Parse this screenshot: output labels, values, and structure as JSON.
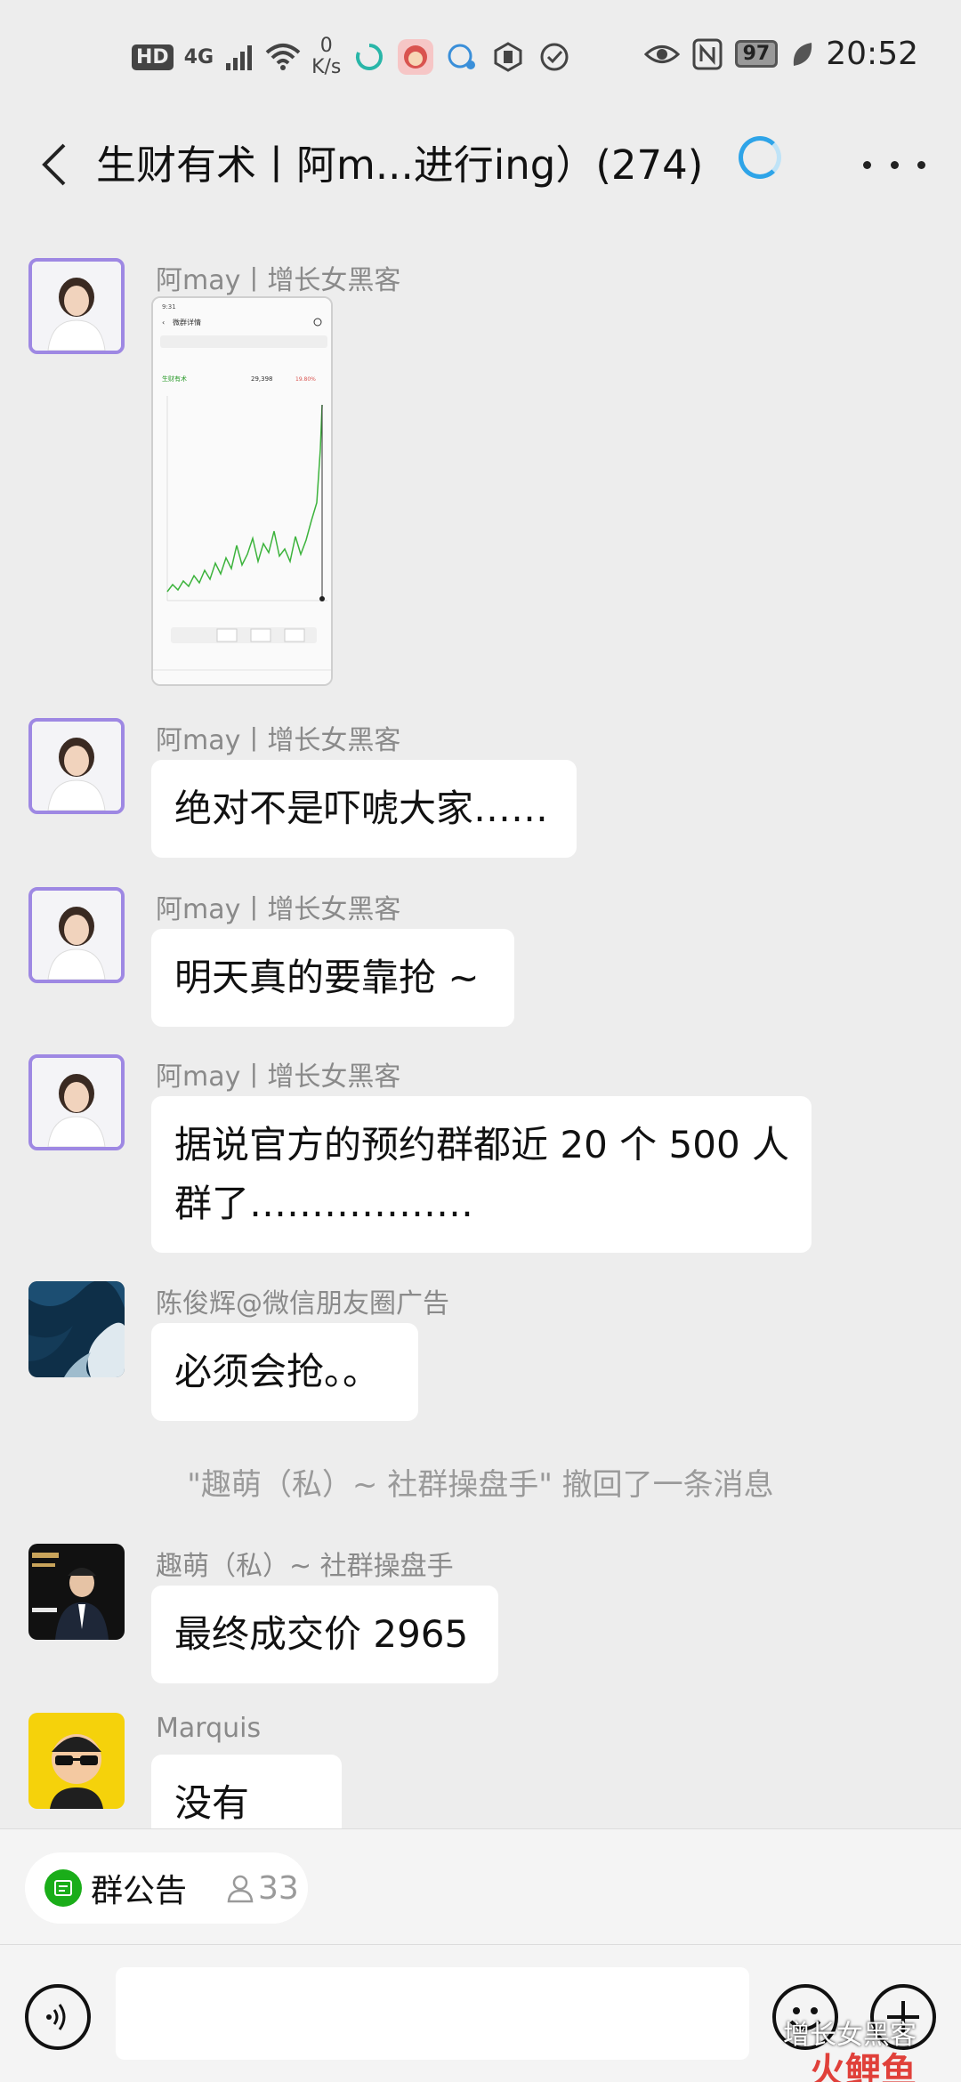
{
  "status_bar": {
    "hd": "HD",
    "network": "4G",
    "speed_value": "0",
    "speed_unit": "K/s",
    "battery": "97",
    "time": "20:52"
  },
  "header": {
    "title": "生财有术丨阿m...进行ing）(274)"
  },
  "messages": [
    {
      "sender": "阿may丨增长女黑客",
      "type": "image"
    },
    {
      "sender": "阿may丨增长女黑客",
      "text": "绝对不是吓唬大家……"
    },
    {
      "sender": "阿may丨增长女黑客",
      "text": "明天真的要靠抢 ~"
    },
    {
      "sender": "阿may丨增长女黑客",
      "text_line1": "据说官方的预约群都近 20 个 500 人",
      "text_line2": "群了………………"
    },
    {
      "sender": "陈俊辉@微信朋友圈广告",
      "text": "必须会抢。。"
    },
    {
      "sender": "趣萌（私）~ 社群操盘手",
      "text": "最终成交价 2965"
    },
    {
      "sender": "Marquis",
      "text": "没有吧？"
    }
  ],
  "recall_notice": "\"趣萌（私）~ 社群操盘手\" 撤回了一条消息",
  "thumbnail": {
    "title": "微群详情",
    "row_name": "生财有术",
    "row_value": "29,398",
    "row_change": "19.80%"
  },
  "footer": {
    "notice_label": "群公告",
    "member_count": "33",
    "input_value": ""
  },
  "watermark": {
    "text": "增长女黑客",
    "brand": "火鲤鱼"
  },
  "colors": {
    "background": "#ededed",
    "bubble": "#ffffff",
    "accent_blue": "#2ea4e8",
    "wechat_green": "#1aad19",
    "avatar_border": "#9e88e3"
  }
}
